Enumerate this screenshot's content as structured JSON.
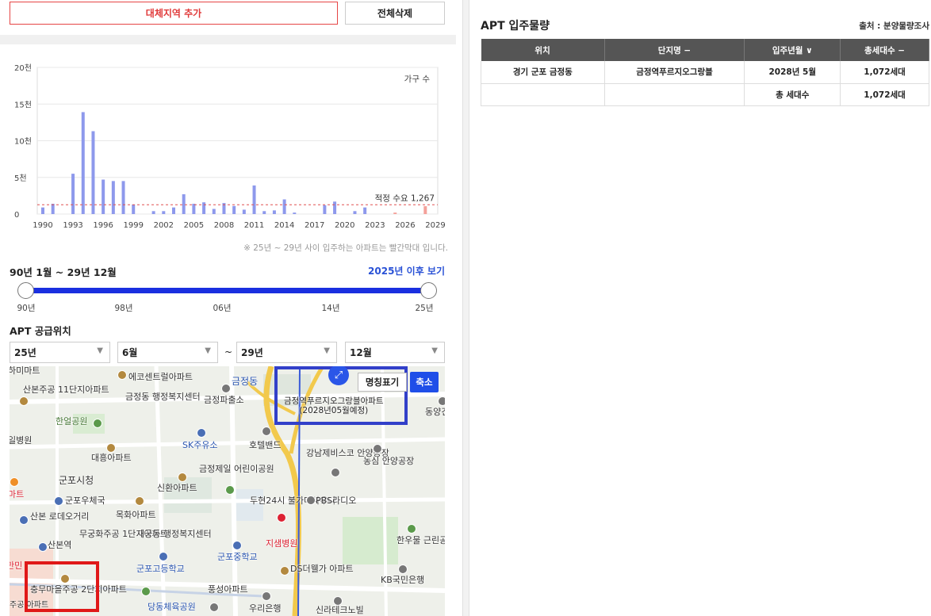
{
  "buttons": {
    "add_region": "대체지역 추가",
    "clear_all": "전체삭제"
  },
  "chart_data": {
    "type": "bar",
    "legend": "가구 수",
    "x_tick_labels": [
      "1990",
      "1993",
      "1996",
      "1999",
      "2002",
      "2005",
      "2008",
      "2011",
      "2014",
      "2017",
      "2020",
      "2023",
      "2026",
      "2029"
    ],
    "y_tick_labels": [
      "20천",
      "15천",
      "10천",
      "5천",
      "0"
    ],
    "ylim": [
      0,
      20000
    ],
    "categories": [
      1990,
      1991,
      1992,
      1993,
      1994,
      1995,
      1996,
      1997,
      1998,
      1999,
      2000,
      2001,
      2002,
      2003,
      2004,
      2005,
      2006,
      2007,
      2008,
      2009,
      2010,
      2011,
      2012,
      2013,
      2014,
      2015,
      2016,
      2017,
      2018,
      2019,
      2020,
      2021,
      2022,
      2023,
      2024,
      2025,
      2026,
      2027,
      2028,
      2029
    ],
    "values": [
      900,
      1400,
      0,
      5500,
      13900,
      11300,
      4700,
      4500,
      4500,
      1300,
      0,
      400,
      400,
      900,
      2700,
      1400,
      1600,
      700,
      1500,
      1100,
      600,
      3900,
      400,
      500,
      2000,
      200,
      0,
      0,
      1200,
      1700,
      0,
      400,
      900,
      0,
      0,
      200,
      0,
      0,
      1072,
      0
    ],
    "future_start_year": 2025,
    "reference_line": {
      "value": 1267,
      "label": "적정 수요 1,267"
    },
    "bar_color": "#8e99ec",
    "future_bar_color": "#f4a19a",
    "reference_color": "#e05050"
  },
  "chart_note": "※ 25년 ~ 29년 사이 입주하는 아파트는 빨간막대 입니다.",
  "range": {
    "title": "90년 1월 ~ 29년 12월",
    "link": "2025년 이후 보기",
    "ticks": [
      "90년",
      "98년",
      "06년",
      "14년",
      "25년"
    ]
  },
  "supply": {
    "title": "APT 공급위치",
    "selects": [
      "25년",
      "6월",
      "29년",
      "12월"
    ],
    "tilde": "~"
  },
  "map": {
    "btn_name": "명칭표기",
    "btn_zoom": "축소",
    "highlight_label": "금정역푸르지오그랑블아파트\n(2028년05월예정)",
    "labels": {
      "l1": "산본주공\n11단지아파트",
      "l2": "금정동\n행정복지센터",
      "l3": "에코센트럴아파트",
      "l4": "금정파출소",
      "l5": "금정동",
      "l6": "한얼공원",
      "l7": "일병원",
      "l8": "SK주유소",
      "l9": "호텔밴드",
      "l10": "강남제비스코\n안양공장",
      "l11": "농심\n안양공장",
      "l12": "대흥아파트",
      "l13": "금정제일\n어린이공원",
      "l14": "군포시청",
      "l15": "신환아파트",
      "l16": "군포우체국",
      "l17": "두현24시\n불가마사우나",
      "l18": "PBS라디오",
      "l19": "산본\n로데오거리",
      "l20": "목화아파트",
      "l21": "무궁화주공\n1단지아파트",
      "l22": "재궁동\n행정복지센터",
      "l23": "지샘병원",
      "l24": "한우물\n근린공원",
      "l25": "산본역",
      "l26": "군포중학교",
      "l27": "군포고등학교",
      "l28": "DS더웰가\n아파트",
      "l29": "KB국민은행",
      "l30": "충무마을주공\n2단지아파트",
      "l31": "풍성아파트",
      "l32": "당동체육공원",
      "l33": "우리은행",
      "l34": "동양건\n안양",
      "l35": "신라테크노빌",
      "l36": "마트",
      "l37": "주공\n아파트",
      "l38": "하미마트",
      "l39": "만민"
    }
  },
  "right": {
    "title": "APT 입주물량",
    "source": "출처 : 분양물량조사",
    "headers": [
      "위치",
      "단지명 −",
      "입주년월 ∨",
      "총세대수 −"
    ],
    "rows": [
      [
        "경기 군포 금정동",
        "금정역푸르지오그랑블",
        "2028년 5월",
        "1,072세대"
      ],
      [
        "",
        "",
        "총 세대수",
        "1,072세대"
      ]
    ]
  }
}
